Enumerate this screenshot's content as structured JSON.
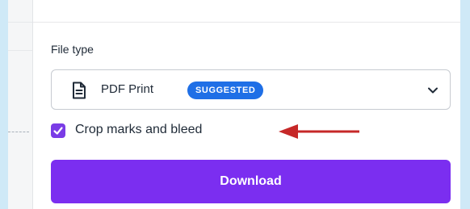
{
  "file_type": {
    "label": "File type",
    "selected": {
      "icon": "document-icon",
      "value": "PDF Print",
      "badge": "SUGGESTED"
    },
    "dropdown_icon": "chevron-down-icon"
  },
  "crop_marks": {
    "label": "Crop marks and bleed",
    "checked": true
  },
  "download_button": {
    "label": "Download"
  },
  "colors": {
    "accent_purple": "#7b2ef0",
    "badge_blue": "#1f6fe6",
    "arrow_red": "#c62828",
    "outer_background": "#cfe9f7"
  }
}
